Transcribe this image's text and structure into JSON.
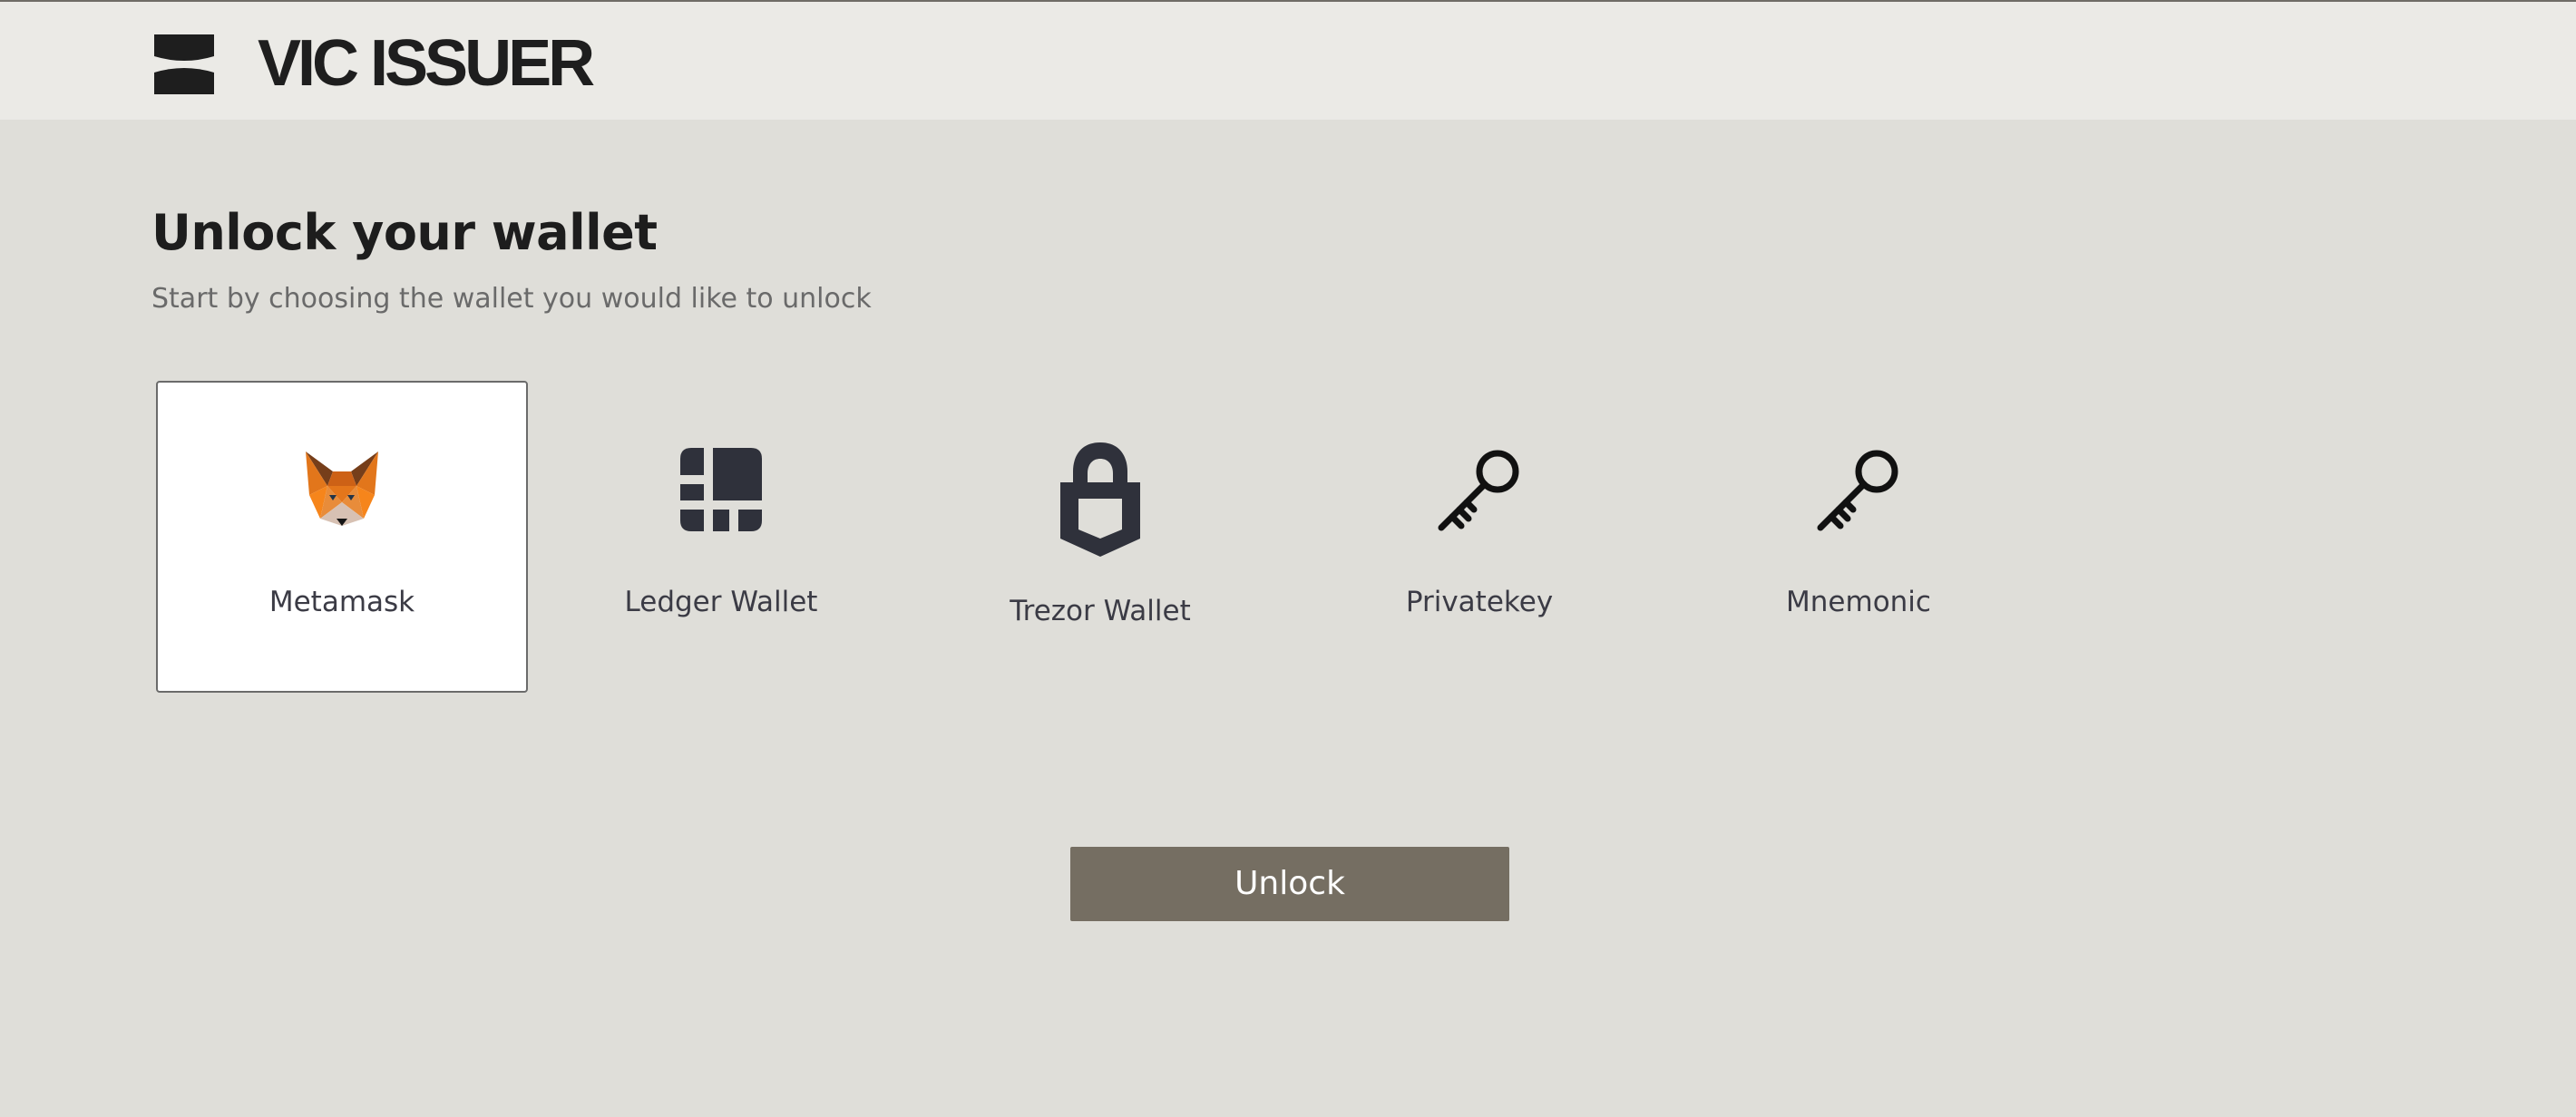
{
  "header": {
    "brand": "VIC ISSUER",
    "logo_icon": "vic-logo-icon"
  },
  "main": {
    "title": "Unlock your wallet",
    "subtitle": "Start by choosing the wallet you would like to unlock"
  },
  "wallets": [
    {
      "label": "Metamask",
      "icon": "metamask-fox-icon",
      "selected": true
    },
    {
      "label": "Ledger Wallet",
      "icon": "ledger-icon",
      "selected": false
    },
    {
      "label": "Trezor Wallet",
      "icon": "trezor-lock-icon",
      "selected": false
    },
    {
      "label": "Privatekey",
      "icon": "key-icon",
      "selected": false
    },
    {
      "label": "Mnemonic",
      "icon": "key-icon",
      "selected": false
    }
  ],
  "actions": {
    "unlock_label": "Unlock"
  },
  "colors": {
    "background": "#dfded9",
    "header_background": "#ebeae6",
    "button": "#756e62",
    "text_dark": "#1d1d1d",
    "icon_dark": "#2f313b"
  }
}
